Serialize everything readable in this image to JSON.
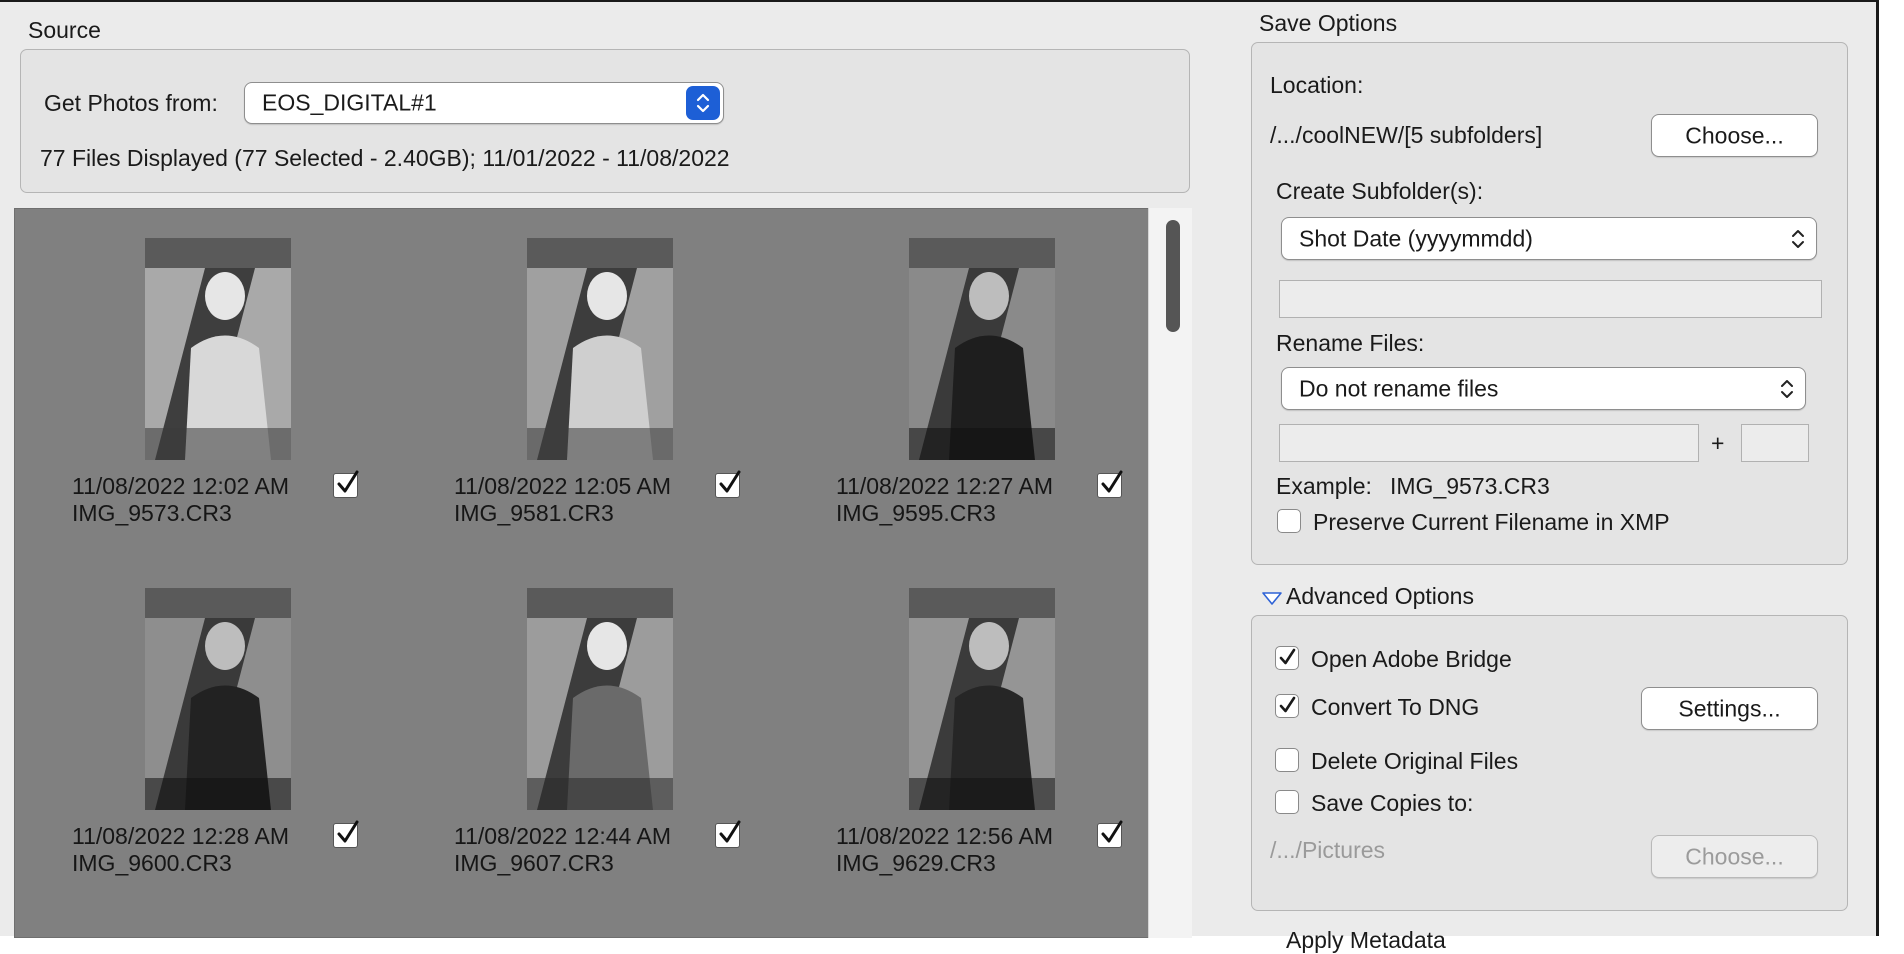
{
  "source": {
    "title": "Source",
    "get_photos_label": "Get Photos from:",
    "device": "EOS_DIGITAL#1",
    "summary": "77 Files Displayed (77 Selected - 2.40GB); 11/01/2022 - 11/08/2022"
  },
  "thumbnails": [
    {
      "datetime": "11/08/2022 12:02 AM",
      "filename": "IMG_9573.CR3",
      "checked": true
    },
    {
      "datetime": "11/08/2022 12:05 AM",
      "filename": "IMG_9581.CR3",
      "checked": true
    },
    {
      "datetime": "11/08/2022 12:27 AM",
      "filename": "IMG_9595.CR3",
      "checked": true
    },
    {
      "datetime": "11/08/2022 12:28 AM",
      "filename": "IMG_9600.CR3",
      "checked": true
    },
    {
      "datetime": "11/08/2022 12:44 AM",
      "filename": "IMG_9607.CR3",
      "checked": true
    },
    {
      "datetime": "11/08/2022 12:56 AM",
      "filename": "IMG_9629.CR3",
      "checked": true
    }
  ],
  "save_options": {
    "title": "Save Options",
    "location_label": "Location:",
    "location_path": "/.../coolNEW/[5 subfolders]",
    "choose_label": "Choose...",
    "create_subfolders_label": "Create Subfolder(s):",
    "create_subfolders_value": "Shot Date (yyyymmdd)",
    "rename_files_label": "Rename Files:",
    "rename_files_value": "Do not rename files",
    "plus": "+",
    "example_label": "Example:",
    "example_value": "IMG_9573.CR3",
    "preserve_label": "Preserve Current Filename in XMP",
    "preserve_checked": false
  },
  "advanced_options": {
    "title": "Advanced Options",
    "open_bridge_label": "Open Adobe Bridge",
    "open_bridge_checked": true,
    "convert_dng_label": "Convert To DNG",
    "convert_dng_checked": true,
    "settings_label": "Settings...",
    "delete_original_label": "Delete Original Files",
    "delete_original_checked": false,
    "save_copies_label": "Save Copies to:",
    "save_copies_checked": false,
    "copies_path": "/.../Pictures",
    "copies_choose_label": "Choose..."
  },
  "apply_metadata": {
    "title": "Apply Metadata"
  }
}
